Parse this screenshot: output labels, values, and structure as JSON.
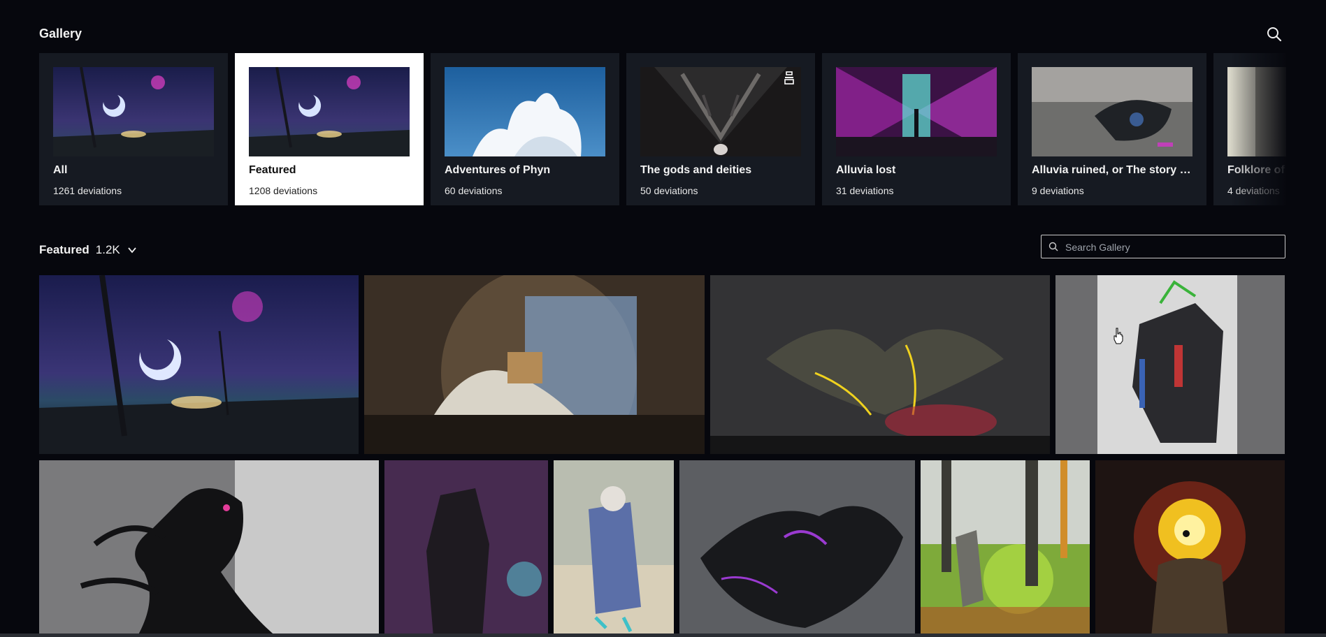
{
  "header": {
    "title": "Gallery"
  },
  "icons": {
    "search": "search-icon",
    "chevron": "chevron-down-icon",
    "premium": "premium-folder-icon"
  },
  "folders": [
    {
      "name": "All",
      "count": "1261 deviations",
      "active": false
    },
    {
      "name": "Featured",
      "count": "1208 deviations",
      "active": true
    },
    {
      "name": "Adventures of Phyn",
      "count": "60 deviations",
      "active": false
    },
    {
      "name": "The gods and deities",
      "count": "50 deviations",
      "active": false
    },
    {
      "name": "Alluvia lost",
      "count": "31 deviations",
      "active": false
    },
    {
      "name": "Alluvia ruined, or The story of...",
      "count": "9 deviations",
      "active": false
    },
    {
      "name": "Folklore of",
      "count": "4 deviations",
      "active": false
    }
  ],
  "section": {
    "title": "Featured",
    "count": "1.2K"
  },
  "search": {
    "placeholder": "Search Gallery"
  },
  "colors": {
    "background": "#06070d",
    "card": "#161a22",
    "active_card": "#ffffff"
  }
}
